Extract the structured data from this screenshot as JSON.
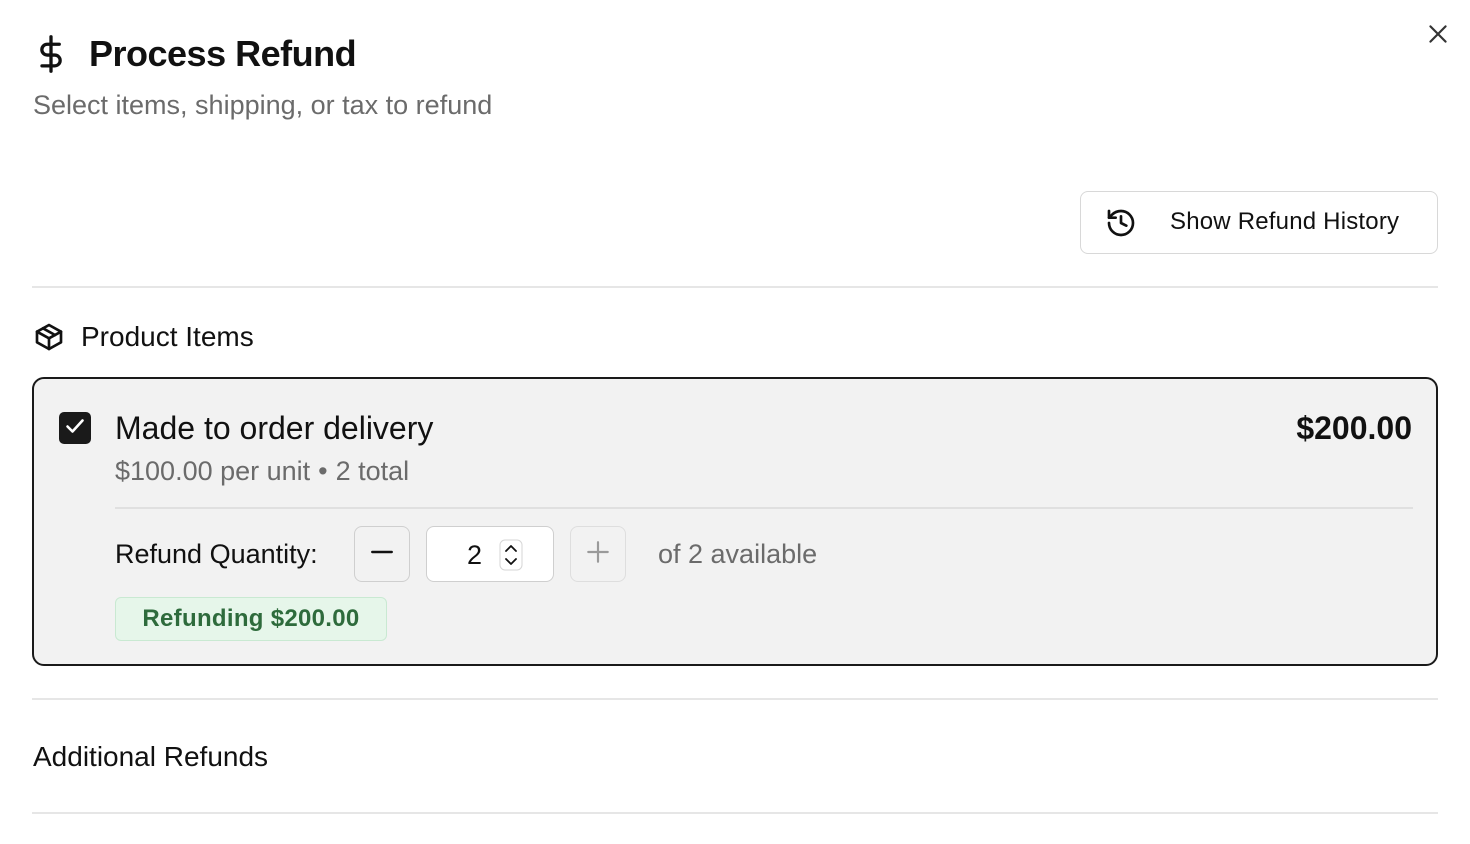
{
  "dialog": {
    "title": "Process Refund",
    "subtitle": "Select items, shipping, or tax to refund"
  },
  "header_actions": {
    "history_label": "Show Refund History"
  },
  "product_items": {
    "section_title": "Product Items",
    "items": [
      {
        "name": "Made to order delivery",
        "price": "$200.00",
        "unit_price": "$100.00 per unit",
        "separator": "•",
        "total_count": "2 total",
        "checked": true,
        "quantity_label": "Refund Quantity:",
        "quantity_value": "2",
        "available_text": "of 2 available",
        "refund_badge": "Refunding $200.00"
      }
    ]
  },
  "additional_refunds": {
    "section_title": "Additional Refunds"
  },
  "icons": {
    "title": "dollar-sign-icon",
    "close": "close-icon",
    "history": "history-icon",
    "section": "package-icon",
    "checkbox": "checkmark-icon",
    "minus": "minus-icon",
    "plus": "plus-icon",
    "spinner": "chevron-up-down-icon"
  },
  "colors": {
    "text": "#111111",
    "muted": "#6b6b6b",
    "card_bg": "#f2f2f2",
    "card_border": "#1a1a1a",
    "badge_bg": "#e6f6ea",
    "badge_text": "#2e6b3c"
  }
}
